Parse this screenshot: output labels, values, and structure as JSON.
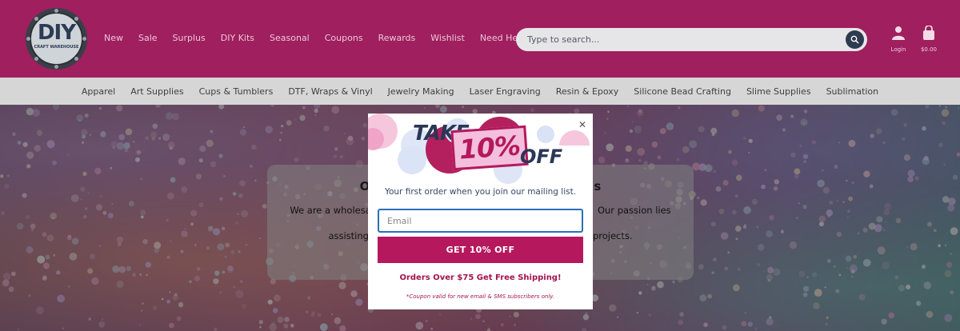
{
  "logo": {
    "main": "DIY",
    "sub": "CRAFT WAREHOUSE"
  },
  "nav": [
    "New",
    "Sale",
    "Surplus",
    "DIY Kits",
    "Seasonal",
    "Coupons",
    "Rewards",
    "Wishlist",
    "Need Help?"
  ],
  "search": {
    "placeholder": "Type to search..."
  },
  "account": {
    "label": "Login",
    "icon": "user-icon"
  },
  "cart": {
    "label": "$0.00",
    "icon": "shopping-bag-icon"
  },
  "categories": [
    "Apparel",
    "Art Supplies",
    "Cups & Tumblers",
    "DTF, Wraps & Vinyl",
    "Jewelry Making",
    "Laser Engraving",
    "Resin & Epoxy",
    "Silicone Bead Crafting",
    "Slime Supplies",
    "Sublimation"
  ],
  "about": {
    "heading_left": "O",
    "heading_right": "s",
    "line1_left": "We are a wholesal",
    "line1_right": "Our passion lies in",
    "line2_left": "assisting",
    "line2_right": "projects."
  },
  "modal": {
    "take": "TAKE",
    "percent": "10%",
    "off": "OFF",
    "tagline": "Your first order when you join our mailing list.",
    "email_placeholder": "Email",
    "cta": "GET 10% OFF",
    "shipping": "Orders Over $75 Get Free Shipping!",
    "fine_print": "*Coupon valid for new email & SMS subscribers only."
  },
  "colors": {
    "header": "#a01f5e",
    "accent": "#b5185d",
    "navy": "#2a3756",
    "category_bar": "#d6d6d6"
  }
}
